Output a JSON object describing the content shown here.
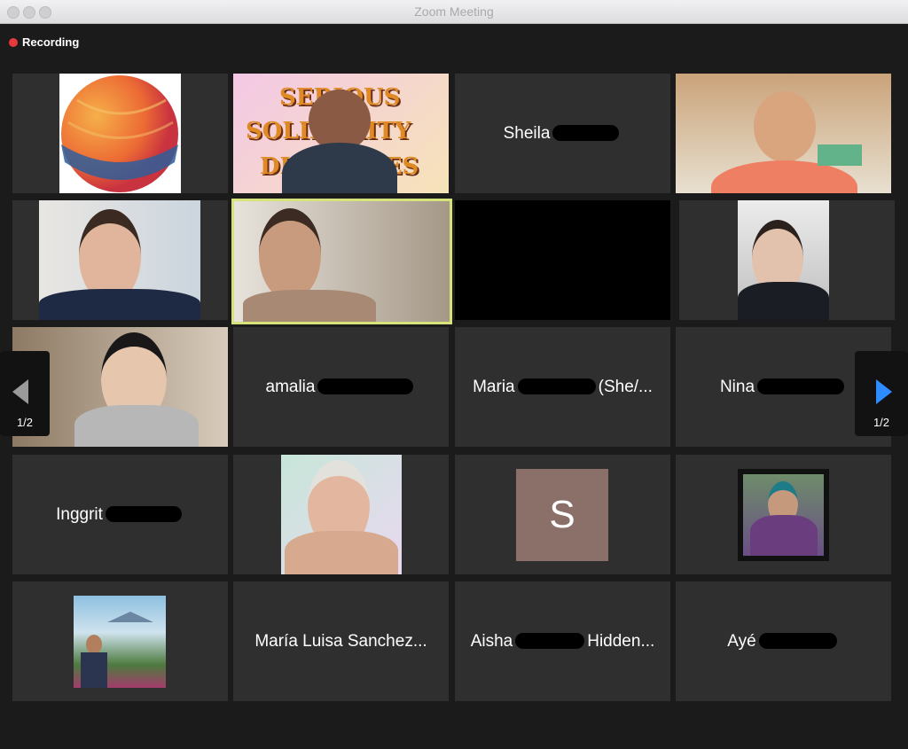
{
  "window": {
    "title": "Zoom Meeting"
  },
  "recording": {
    "label": "Recording"
  },
  "pagination": {
    "left_page": "1/2",
    "right_page": "1/2"
  },
  "tiles": {
    "sheila": {
      "name": "Sheila"
    },
    "amalia": {
      "name": "amalia"
    },
    "maria": {
      "name": "Maria",
      "suffix": "(She/..."
    },
    "nina": {
      "name": "Nina"
    },
    "inggrit": {
      "name": "Inggrit"
    },
    "s_avatar": {
      "initial": "S"
    },
    "maria_luisa": {
      "name": "María Luisa Sanchez..."
    },
    "aisha": {
      "name": "Aisha",
      "suffix": "Hidden..."
    },
    "aye": {
      "name": "Ayé"
    },
    "banner": {
      "text_line1": "SERIOUS",
      "text_line2": "SOLIDARITY",
      "text_line3": "DIALOGUES"
    }
  },
  "colors": {
    "accent_active": "#d6e37a",
    "nav_arrow_active": "#2d8cff",
    "recording_dot": "#e5393a"
  }
}
